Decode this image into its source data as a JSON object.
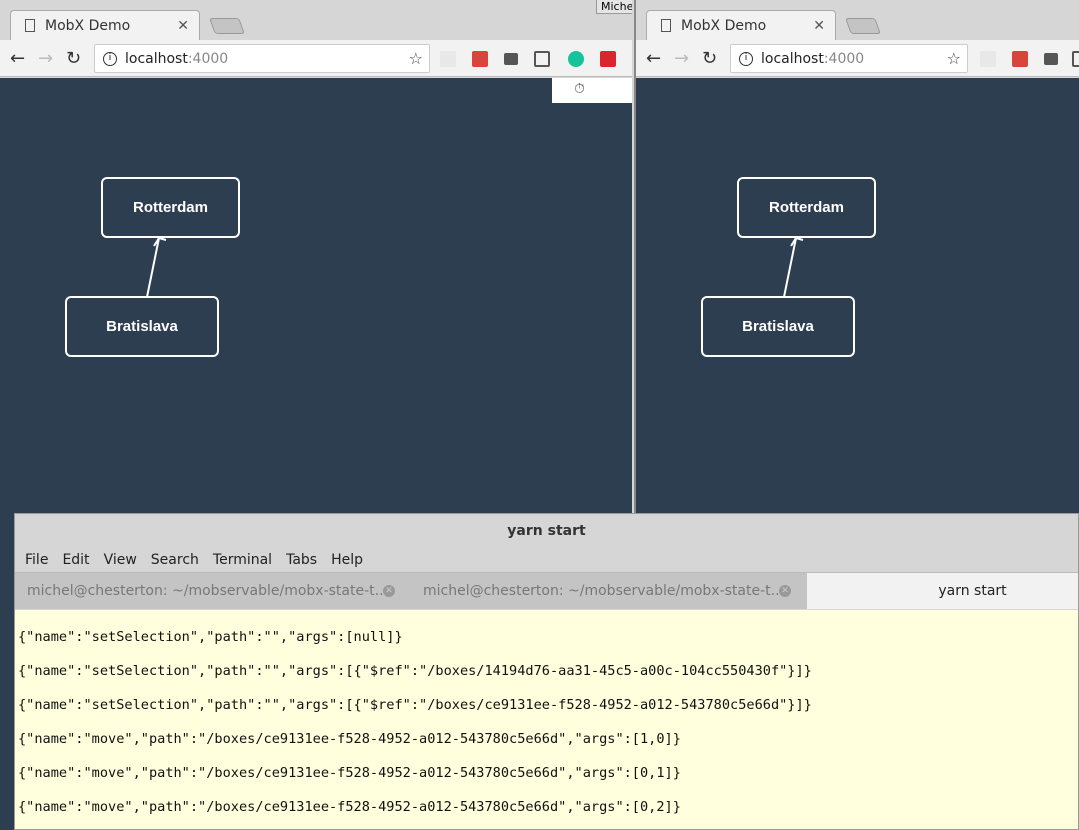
{
  "browsers": [
    {
      "tab_title": "MobX Demo",
      "url_host": "localhost",
      "url_port": ":4000",
      "nodes": [
        "Rotterdam",
        "Bratislava"
      ]
    },
    {
      "tab_title": "MobX Demo",
      "url_host": "localhost",
      "url_port": ":4000",
      "nodes": [
        "Rotterdam",
        "Bratislava"
      ]
    }
  ],
  "profile_label": "Miche",
  "colors": {
    "canvas": "#2c3e50",
    "terminal_bg": "#ffffdd"
  },
  "terminal": {
    "title": "yarn start",
    "menu": [
      "File",
      "Edit",
      "View",
      "Search",
      "Terminal",
      "Tabs",
      "Help"
    ],
    "tabs": [
      "michel@chesterton: ~/mobservable/mobx-state-t...",
      "michel@chesterton: ~/mobservable/mobx-state-t...",
      "yarn start"
    ],
    "lines": [
      "{\"name\":\"setSelection\",\"path\":\"\",\"args\":[null]}",
      "{\"name\":\"setSelection\",\"path\":\"\",\"args\":[{\"$ref\":\"/boxes/14194d76-aa31-45c5-a00c-104cc550430f\"}]}",
      "{\"name\":\"setSelection\",\"path\":\"\",\"args\":[{\"$ref\":\"/boxes/ce9131ee-f528-4952-a012-543780c5e66d\"}]}",
      "{\"name\":\"move\",\"path\":\"/boxes/ce9131ee-f528-4952-a012-543780c5e66d\",\"args\":[1,0]}",
      "{\"name\":\"move\",\"path\":\"/boxes/ce9131ee-f528-4952-a012-543780c5e66d\",\"args\":[0,1]}",
      "{\"name\":\"move\",\"path\":\"/boxes/ce9131ee-f528-4952-a012-543780c5e66d\",\"args\":[0,2]}"
    ]
  }
}
